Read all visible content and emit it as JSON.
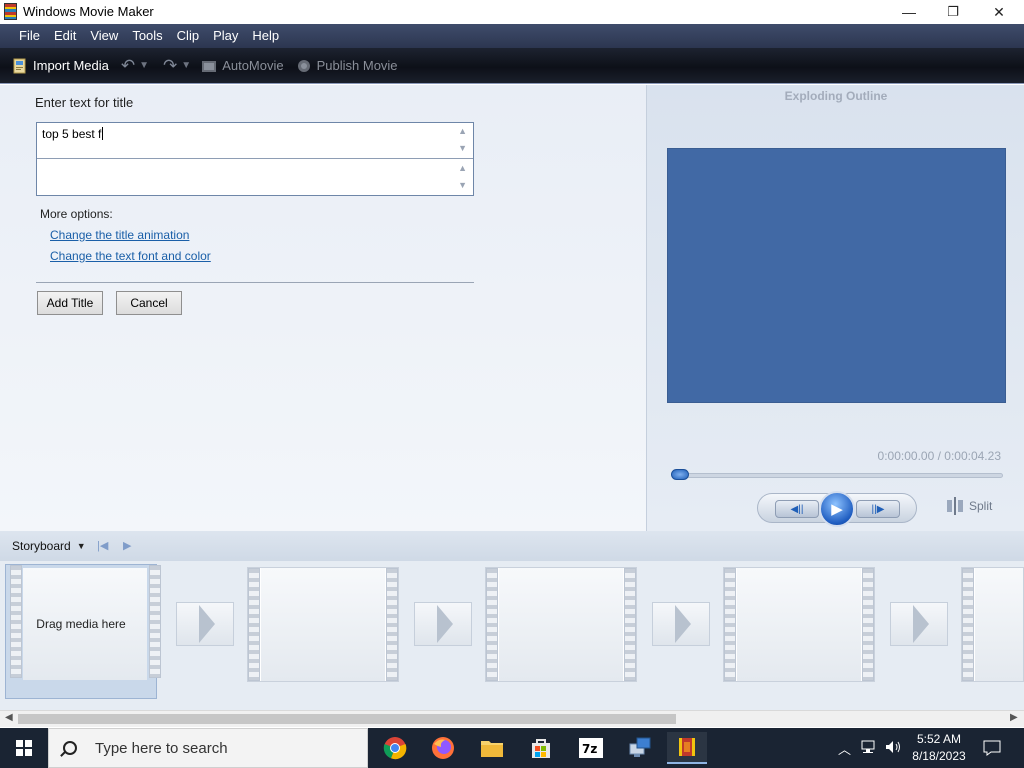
{
  "window": {
    "title": "Windows Movie Maker",
    "minimize": "—",
    "maximize": "❐",
    "close": "✕"
  },
  "menu": [
    "File",
    "Edit",
    "View",
    "Tools",
    "Clip",
    "Play",
    "Help"
  ],
  "toolbar": {
    "import_media": "Import Media",
    "automovie": "AutoMovie",
    "publish_movie": "Publish Movie"
  },
  "title_editor": {
    "label": "Enter text for title",
    "line1_value": "top 5 best f",
    "line2_value": "",
    "more_options_label": "More options:",
    "link_animation": "Change the title animation",
    "link_font_color": "Change the text font and color",
    "add_title_button": "Add Title",
    "cancel_button": "Cancel"
  },
  "preview": {
    "animation_name": "Exploding Outline",
    "time_readout": "0:00:00.00 / 0:00:04.23",
    "seek_position": 0,
    "split_label": "Split",
    "screen_color": "#4169a5"
  },
  "storyboard": {
    "label": "Storyboard",
    "drop_hint": "Drag media here"
  },
  "taskbar": {
    "search_placeholder": "Type here to search",
    "apps": [
      "chrome-icon",
      "firefox-icon",
      "file-explorer-icon",
      "microsoft-store-icon",
      "7zip-icon",
      "remote-desktop-icon",
      "movie-maker-icon"
    ],
    "time": "5:52 AM",
    "date": "8/18/2023"
  }
}
